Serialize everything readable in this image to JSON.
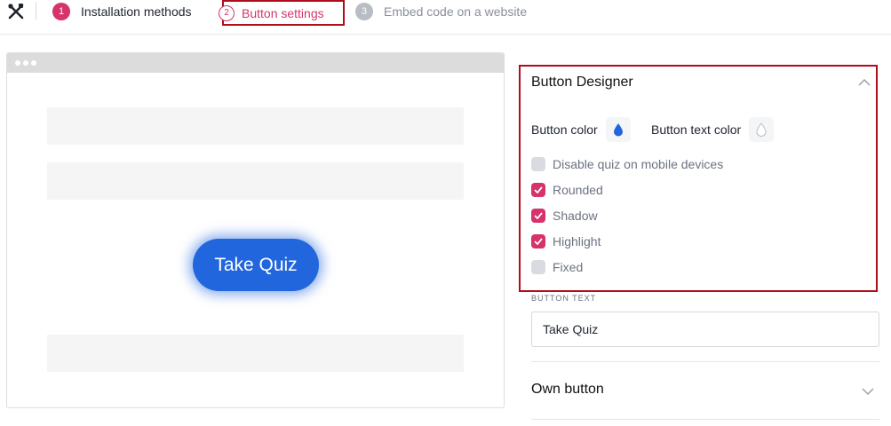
{
  "steps": [
    {
      "num": "1",
      "label": "Installation methods"
    },
    {
      "num": "2",
      "label": "Button settings"
    },
    {
      "num": "3",
      "label": "Embed code on a website"
    }
  ],
  "preview": {
    "button_label": "Take Quiz",
    "button_color": "#2266dd"
  },
  "designer": {
    "title": "Button Designer",
    "button_color_label": "Button color",
    "button_text_color_label": "Button text color",
    "options": [
      {
        "label": "Disable quiz on mobile devices",
        "checked": false
      },
      {
        "label": "Rounded",
        "checked": true
      },
      {
        "label": "Shadow",
        "checked": true
      },
      {
        "label": "Highlight",
        "checked": true
      },
      {
        "label": "Fixed",
        "checked": false
      }
    ]
  },
  "button_text": {
    "label": "BUTTON TEXT",
    "value": "Take Quiz"
  },
  "own_button": {
    "title": "Own button"
  },
  "colors": {
    "accent": "#d6336c",
    "highlight_border": "#b00d1a"
  }
}
